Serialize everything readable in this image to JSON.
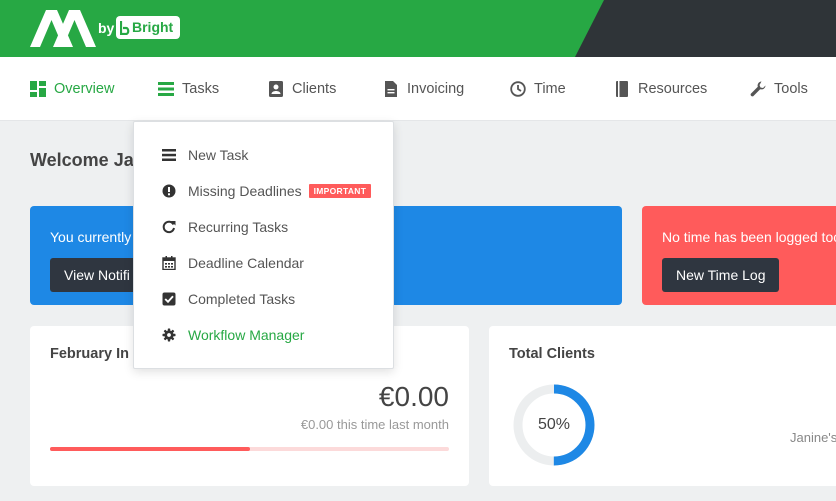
{
  "brand": {
    "by": "by",
    "partner": "Bright"
  },
  "colors": {
    "brand_green": "#27a844",
    "header_dark": "#2f3438",
    "info_blue": "#1e88e5",
    "danger_red": "#ff5b5b",
    "button_dark": "#2f3640"
  },
  "nav": {
    "items": [
      {
        "label": "Overview",
        "icon": "grid-icon"
      },
      {
        "label": "Tasks",
        "icon": "list-icon"
      },
      {
        "label": "Clients",
        "icon": "contact-card-icon"
      },
      {
        "label": "Invoicing",
        "icon": "document-icon"
      },
      {
        "label": "Time",
        "icon": "clock-icon"
      },
      {
        "label": "Resources",
        "icon": "book-icon"
      },
      {
        "label": "Tools",
        "icon": "wrench-icon"
      }
    ]
  },
  "tasks_menu": {
    "items": [
      {
        "label": "New Task",
        "icon": "list-icon"
      },
      {
        "label": "Missing Deadlines",
        "icon": "exclamation-circle-icon",
        "badge": "IMPORTANT"
      },
      {
        "label": "Recurring Tasks",
        "icon": "refresh-icon"
      },
      {
        "label": "Deadline Calendar",
        "icon": "calendar-icon"
      },
      {
        "label": "Completed Tasks",
        "icon": "checked-box-icon"
      },
      {
        "label": "Workflow Manager",
        "icon": "gear-icon"
      }
    ]
  },
  "welcome": {
    "text": "Welcome Ja"
  },
  "alerts": {
    "notifications": {
      "text": "You currently",
      "button": "View Notifi"
    },
    "time": {
      "text": "No time has been logged toc",
      "button": "New Time Log"
    }
  },
  "income": {
    "title": "February In",
    "amount": "€0.00",
    "comparison": "€0.00 this time last month",
    "progress_percent": 50
  },
  "clients": {
    "title": "Total Clients",
    "percent_label": "50%",
    "percent": 50,
    "owner": "Janine's"
  }
}
